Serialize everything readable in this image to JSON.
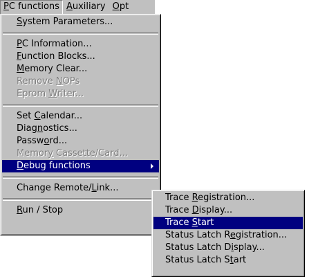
{
  "menubar": {
    "items": [
      {
        "pre": "",
        "key": "P",
        "post": "C functions"
      },
      {
        "pre": "",
        "key": "A",
        "post": "uxiliary"
      },
      {
        "pre": "",
        "key": "O",
        "post": "pt"
      }
    ]
  },
  "main_menu": {
    "items": [
      {
        "pre": "",
        "key": "S",
        "post": "ystem Parameters..."
      },
      {
        "pre": "",
        "key": "P",
        "post": "C Information..."
      },
      {
        "pre": "",
        "key": "F",
        "post": "unction Blocks..."
      },
      {
        "pre": "",
        "key": "M",
        "post": "emory Clear..."
      },
      {
        "pre": "Remove ",
        "key": "N",
        "post": "OPs"
      },
      {
        "pre": "Eprom ",
        "key": "W",
        "post": "riter..."
      },
      {
        "pre": "Set ",
        "key": "C",
        "post": "alendar..."
      },
      {
        "pre": "Diag",
        "key": "n",
        "post": "ostics..."
      },
      {
        "pre": "Passw",
        "key": "o",
        "post": "rd..."
      },
      {
        "pre": "Memor",
        "key": "y",
        "post": " Cassette/Card..."
      },
      {
        "pre": "",
        "key": "D",
        "post": "ebug functions"
      },
      {
        "pre": "Change Remote/",
        "key": "L",
        "post": "ink..."
      },
      {
        "pre": "",
        "key": "R",
        "post": "un / Stop"
      }
    ]
  },
  "sub_menu": {
    "items": [
      {
        "pre": "Trace ",
        "key": "R",
        "post": "egistration..."
      },
      {
        "pre": "Trace ",
        "key": "D",
        "post": "isplay..."
      },
      {
        "pre": "Trace ",
        "key": "S",
        "post": "tart"
      },
      {
        "pre": "Status Latch R",
        "key": "e",
        "post": "gistration..."
      },
      {
        "pre": "Status Latch D",
        "key": "i",
        "post": "splay..."
      },
      {
        "pre": "Status Latch S",
        "key": "t",
        "post": "art"
      }
    ]
  }
}
